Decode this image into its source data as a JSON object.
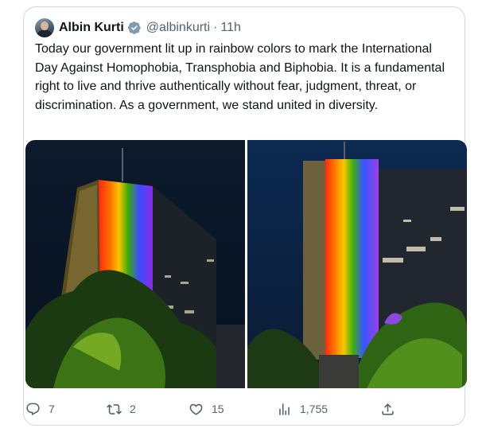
{
  "tweet": {
    "author_name": "Albin Kurti",
    "handle": "@albinkurti",
    "separator": "·",
    "time": "11h",
    "text": "Today our government lit up in rainbow colors to mark the International Day Against Homophobia, Transphobia and Biphobia. It is a fundamental right to live and thrive authentically without fear, judgment, threat, or discrimination. As a government, we stand united in diversity."
  },
  "actions": {
    "replies": "7",
    "reposts": "2",
    "likes": "15",
    "views": "1,755"
  },
  "icons": {
    "verified": "verified-badge-icon",
    "reply": "reply-icon",
    "repost": "repost-icon",
    "like": "heart-icon",
    "views": "views-icon",
    "share": "share-icon"
  },
  "colors": {
    "verified_badge": "#829aab",
    "secondary_text": "#536471",
    "border": "#cfd9de"
  }
}
